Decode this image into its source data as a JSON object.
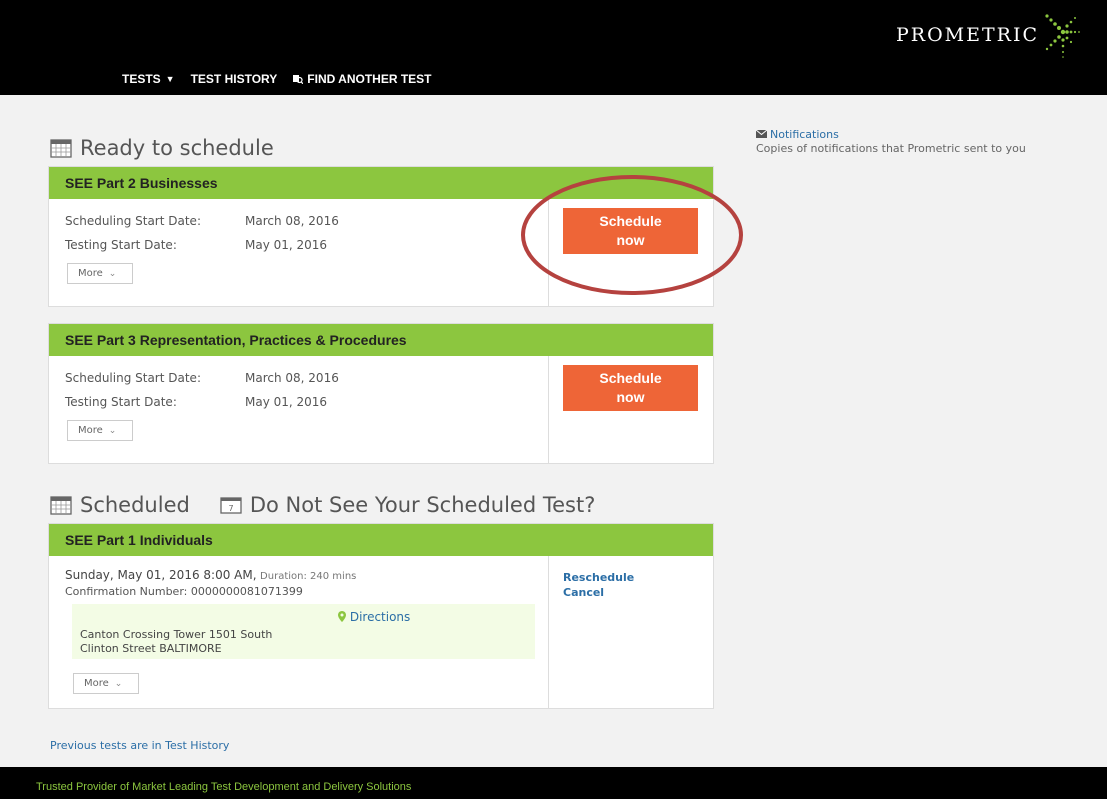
{
  "brand": {
    "name": "PROMETRIC"
  },
  "nav": {
    "tests": "TESTS",
    "test_history": "TEST HISTORY",
    "find_another": "FIND ANOTHER TEST"
  },
  "ready": {
    "title": "Ready to schedule",
    "cards": [
      {
        "name": "SEE Part 2 Businesses",
        "sched_label": "Scheduling Start Date:",
        "sched_date": "March 08, 2016",
        "test_label": "Testing Start Date:",
        "test_date": "May 01, 2016",
        "more": "More",
        "btn_line1": "Schedule",
        "btn_line2": "now"
      },
      {
        "name": "SEE Part 3 Representation, Practices & Procedures",
        "sched_label": "Scheduling Start Date:",
        "sched_date": "March 08, 2016",
        "test_label": "Testing Start Date:",
        "test_date": "May 01, 2016",
        "more": "More",
        "btn_line1": "Schedule",
        "btn_line2": "now"
      }
    ]
  },
  "scheduled": {
    "title": "Scheduled",
    "not_see": "Do Not See Your Scheduled Test?",
    "card": {
      "name": "SEE Part 1 Individuals",
      "when": "Sunday, May 01, 2016 8:00 AM,",
      "duration": "Duration: 240 mins",
      "confirmation": "Confirmation Number: 0000000081071399",
      "directions": "Directions",
      "address_line1": "Canton Crossing Tower 1501 South",
      "address_line2": "Clinton Street BALTIMORE",
      "more": "More",
      "reschedule": "Reschedule",
      "cancel": "Cancel"
    }
  },
  "notifications": {
    "title": "Notifications",
    "desc": "Copies of notifications that Prometric sent to you"
  },
  "prev_tests": "Previous tests are in Test History",
  "footer": "Trusted Provider of Market Leading Test Development and Delivery Solutions",
  "colors": {
    "green": "#8cc63f",
    "orange": "#ee6537",
    "link": "#2b6ea6",
    "annotation": "#b5423f"
  }
}
